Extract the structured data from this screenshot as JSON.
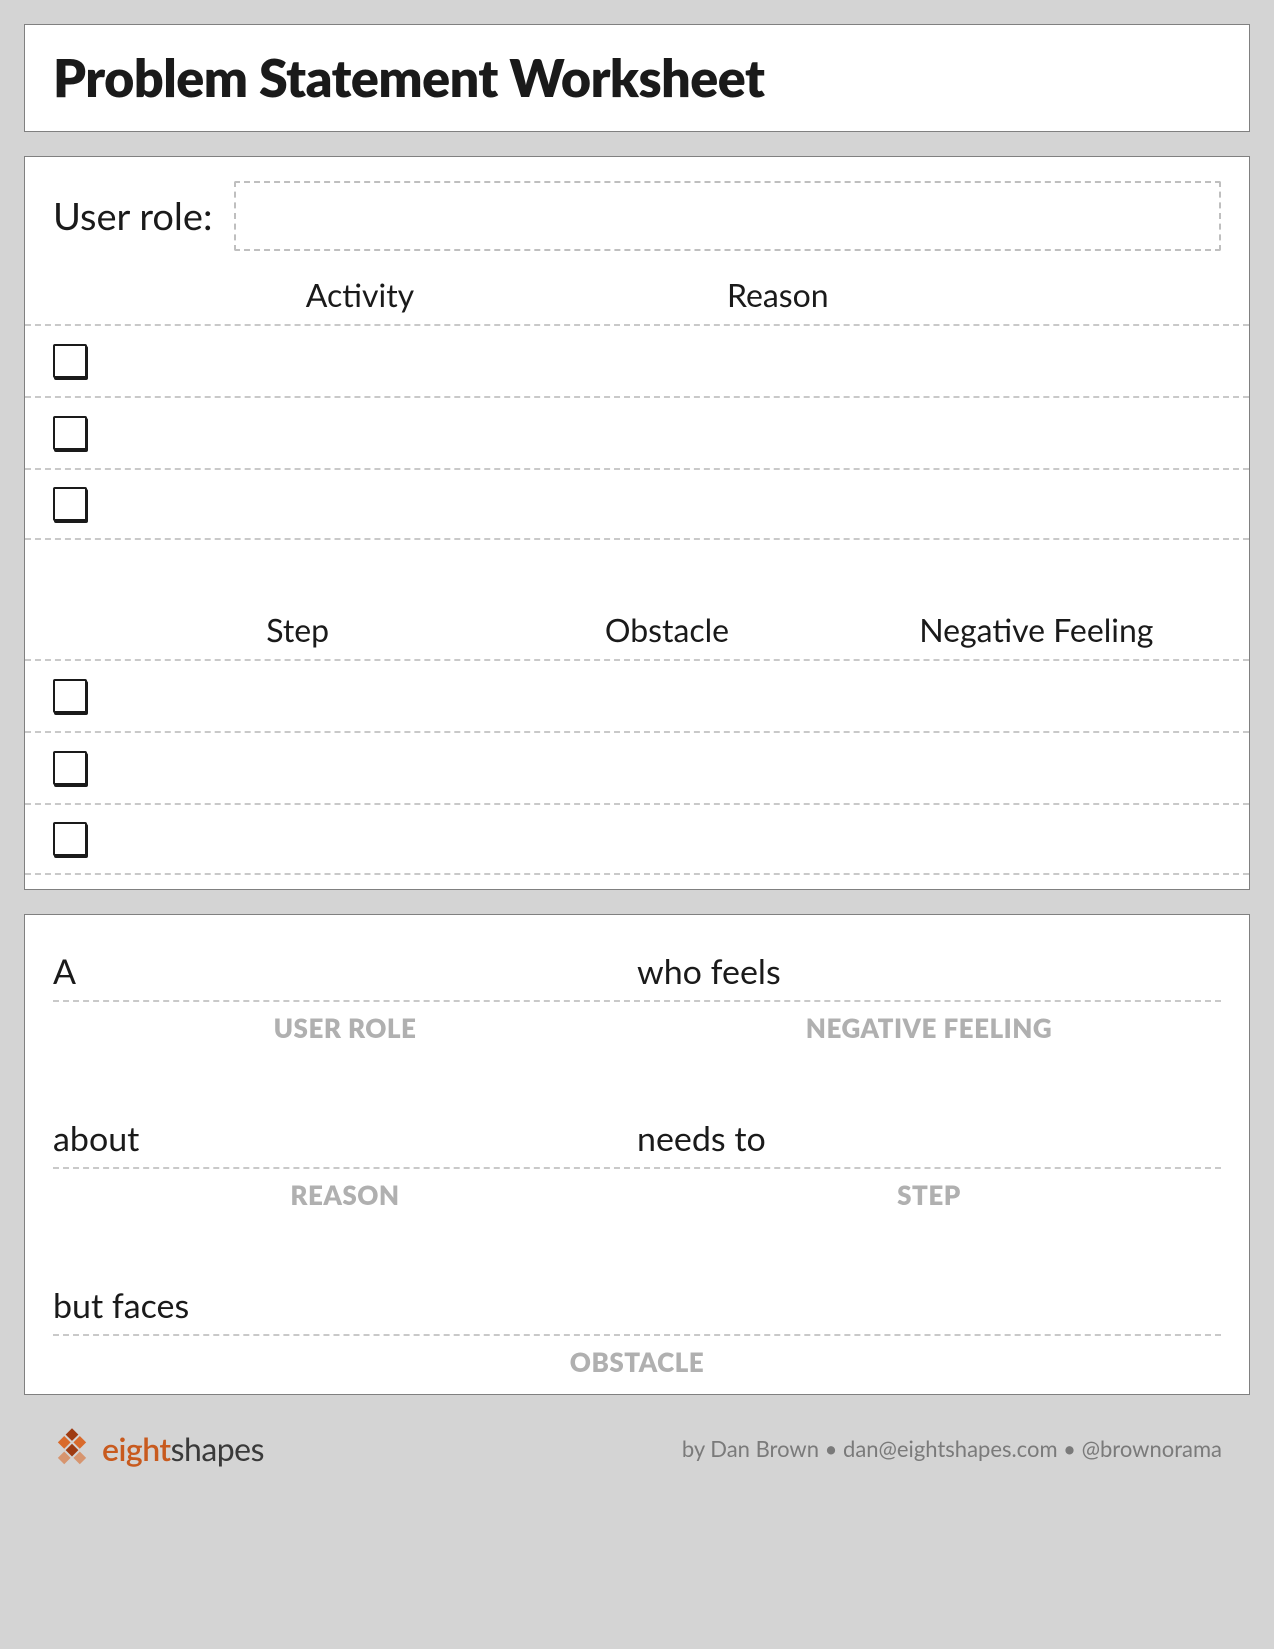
{
  "title": "Problem Statement Worksheet",
  "section1": {
    "user_role_label": "User role:",
    "table1": {
      "headers": [
        "Activity",
        "Reason"
      ],
      "rows": 3
    },
    "table2": {
      "headers": [
        "Step",
        "Obstacle",
        "Negative Feeling"
      ],
      "rows": 3
    }
  },
  "statement": {
    "slots": [
      {
        "prompt_a": "A",
        "prompt_b": "who feels",
        "label_a": "USER ROLE",
        "label_b": "NEGATIVE FEELING"
      },
      {
        "prompt_a": "about",
        "prompt_b": "needs to",
        "label_a": "REASON",
        "label_b": "STEP"
      },
      {
        "prompt_a": "but faces",
        "label_a": "OBSTACLE"
      }
    ]
  },
  "footer": {
    "brand_prefix": "eight",
    "brand_suffix": "shapes",
    "byline": "by Dan Brown • dan@eightshapes.com • @brownorama"
  }
}
